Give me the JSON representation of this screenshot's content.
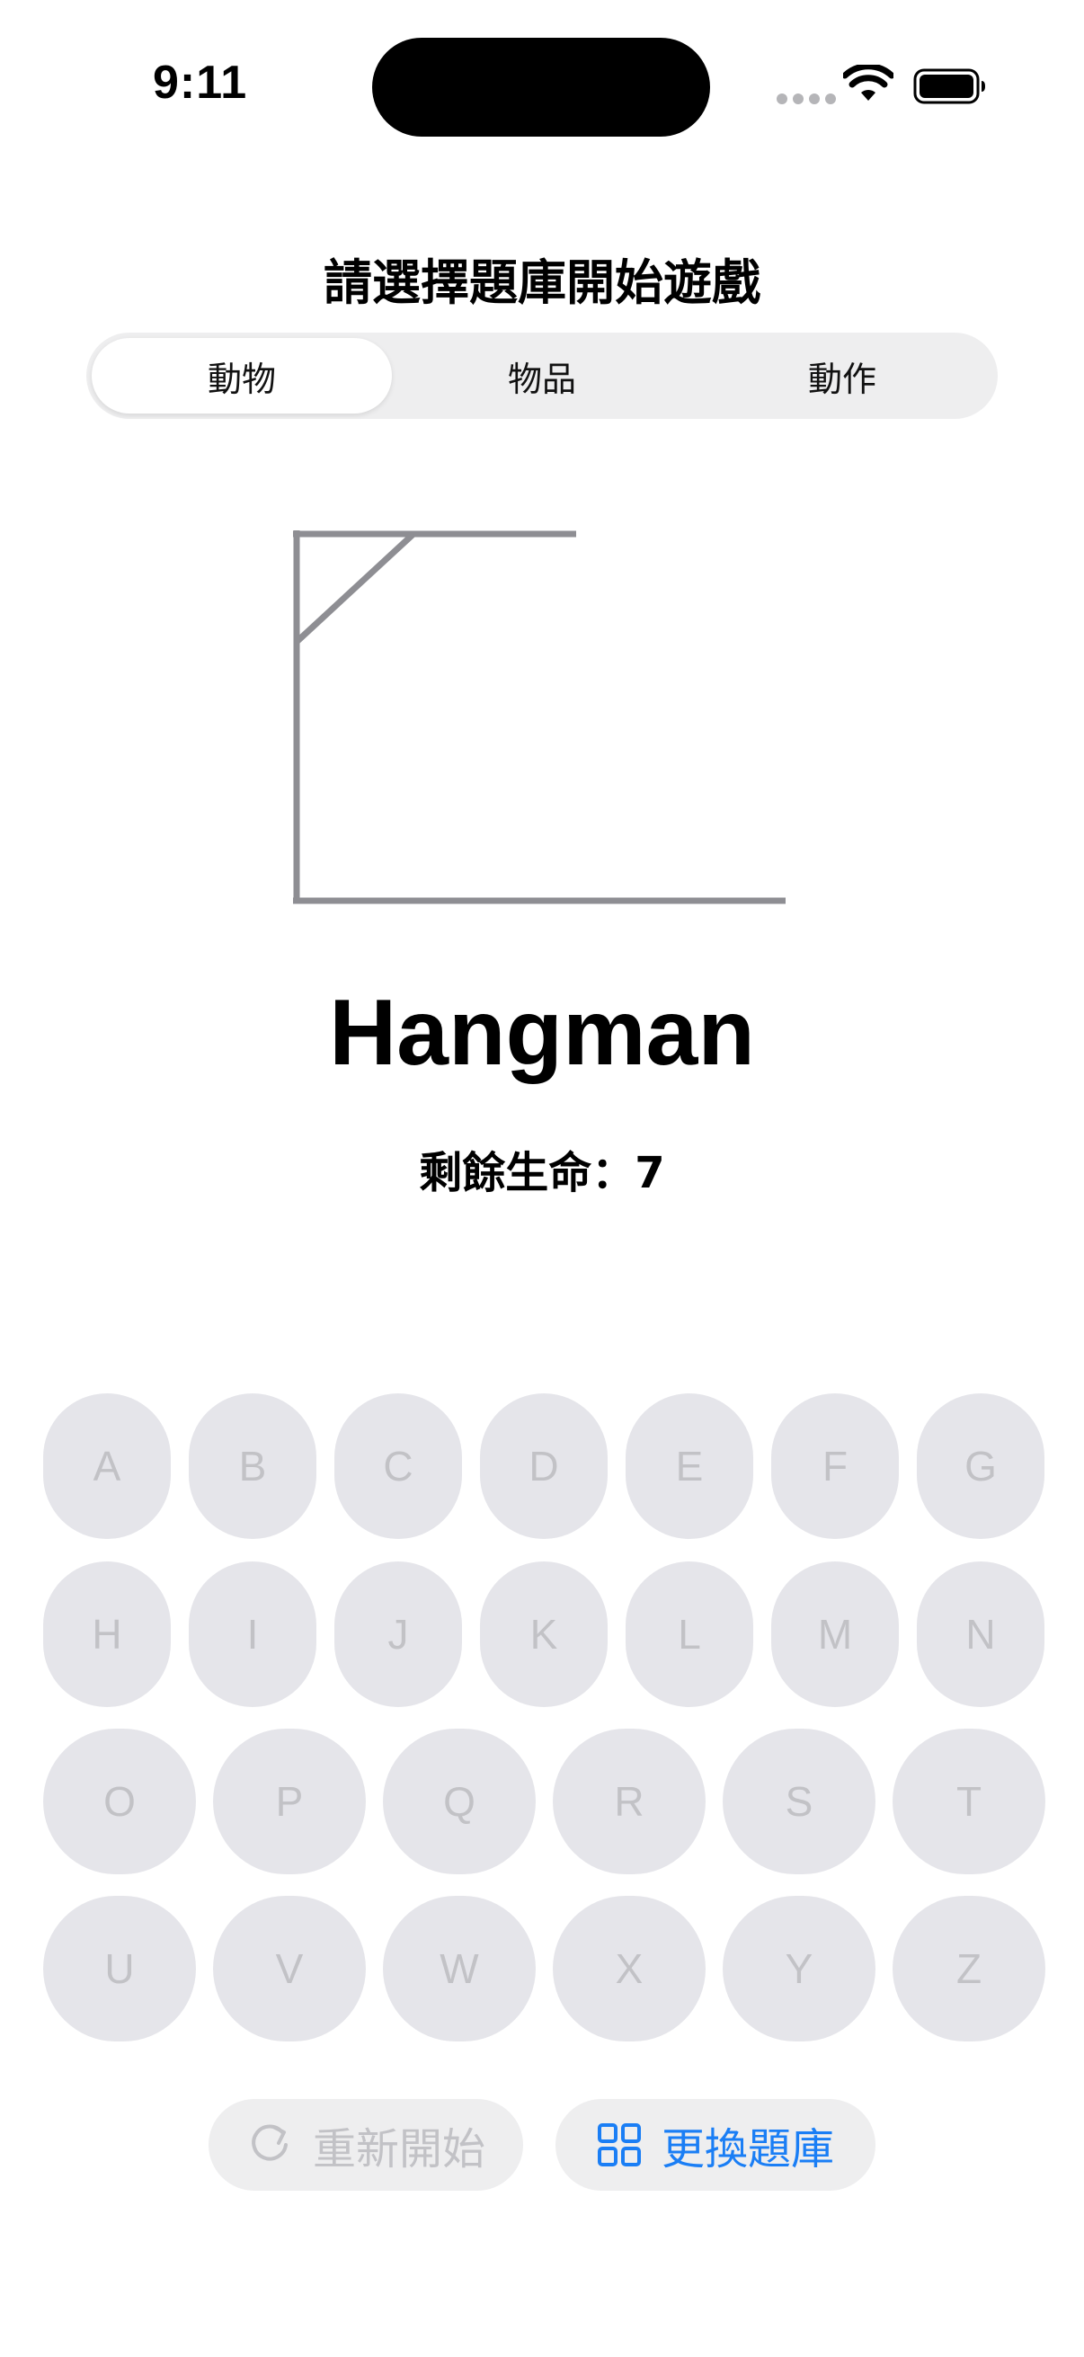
{
  "status_bar": {
    "time": "9:11"
  },
  "header": {
    "title": "請選擇題庫開始遊戲"
  },
  "categories": [
    {
      "label": "動物",
      "selected": true
    },
    {
      "label": "物品",
      "selected": false
    },
    {
      "label": "動作",
      "selected": false
    }
  ],
  "game": {
    "title": "Hangman",
    "lives_text": "剩餘生命：7",
    "lives": 7
  },
  "keyboard": {
    "rows": [
      [
        "A",
        "B",
        "C",
        "D",
        "E",
        "F",
        "G"
      ],
      [
        "H",
        "I",
        "J",
        "K",
        "L",
        "M",
        "N"
      ],
      [
        "O",
        "P",
        "Q",
        "R",
        "S",
        "T"
      ],
      [
        "U",
        "V",
        "W",
        "X",
        "Y",
        "Z"
      ]
    ],
    "enabled": false
  },
  "actions": {
    "restart_label": "重新開始",
    "restart_icon": "arrow-clockwise-icon",
    "change_bank_label": "更換題庫",
    "change_bank_icon": "grid-icon"
  },
  "colors": {
    "accent": "#1a7ef5",
    "disabled_text": "#c2c2c6",
    "key_bg": "#e5e5ea",
    "gallows": "#8e8e93"
  }
}
